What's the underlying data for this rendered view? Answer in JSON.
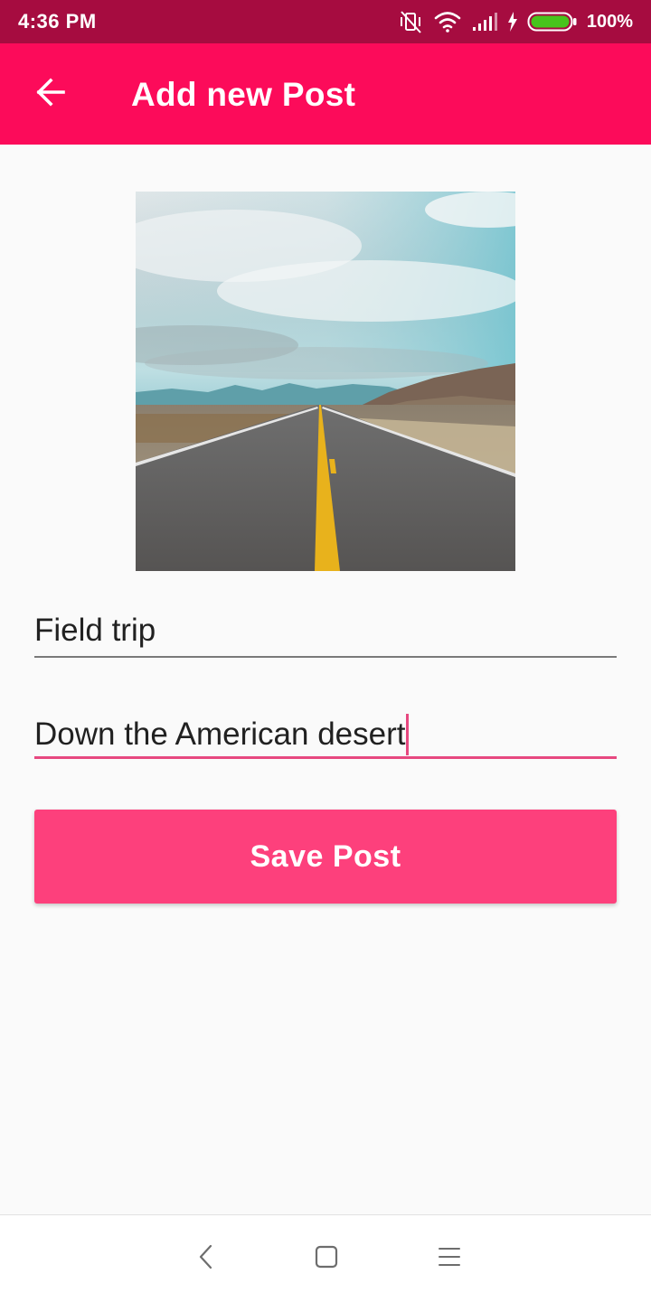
{
  "status_bar": {
    "time": "4:36 PM",
    "battery": "100%",
    "icons": [
      "vibrate-off-icon",
      "wifi-icon",
      "signal-icon",
      "charging-icon",
      "battery-icon"
    ]
  },
  "app_bar": {
    "title": "Add new Post",
    "back_icon": "arrow-back-icon"
  },
  "photo": {
    "icon": "desert-road-photo"
  },
  "form": {
    "title_value": "Field trip",
    "description_value": "Down the American desert",
    "save_label": "Save Post"
  },
  "nav_bar": {
    "icons": [
      "nav-back-icon",
      "nav-home-icon",
      "nav-menu-icon"
    ]
  },
  "colors": {
    "status_bar": "#a60c40",
    "app_bar": "#fc0b5a",
    "accent": "#fd407c",
    "focused_underline": "#e74880",
    "background": "#fafafa"
  }
}
